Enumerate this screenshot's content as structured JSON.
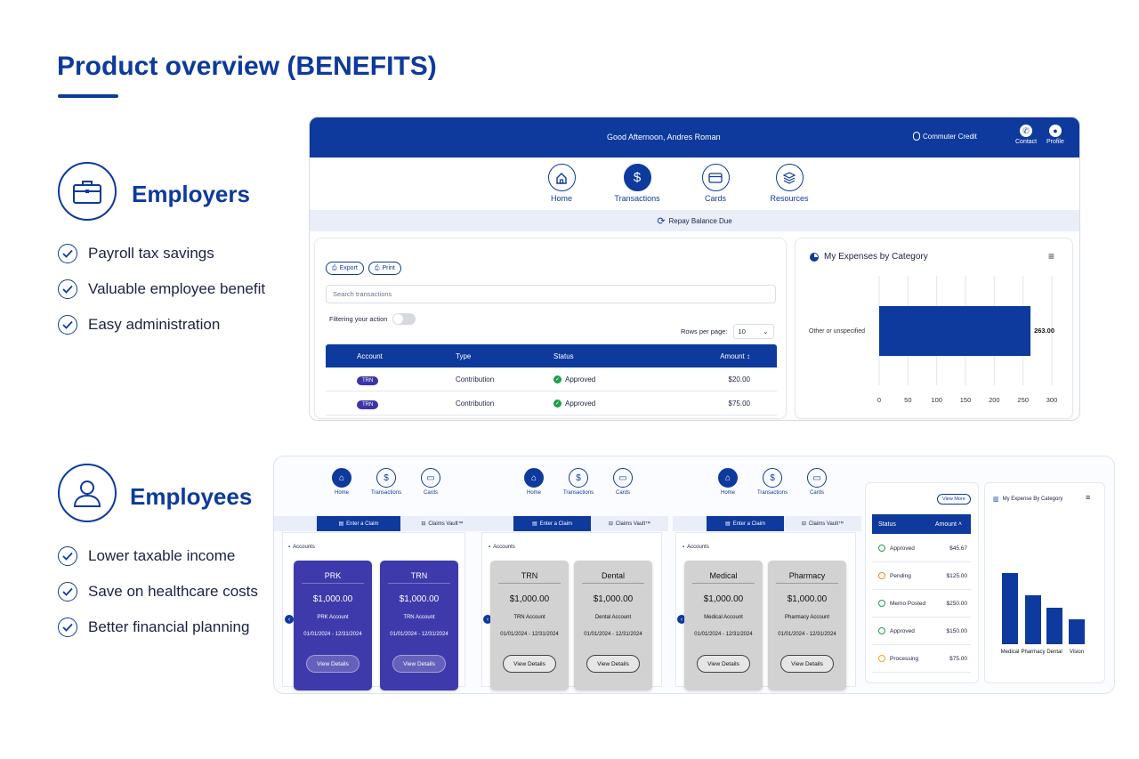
{
  "page_title": "Product overview (BENEFITS)",
  "employers": {
    "heading": "Employers",
    "features": [
      "Payroll tax savings",
      "Valuable employee benefit",
      "Easy administration"
    ]
  },
  "employees": {
    "heading": "Employees",
    "features": [
      "Lower taxable income",
      "Save on healthcare costs",
      "Better financial planning"
    ]
  },
  "dashboard": {
    "greeting": "Good Afternoon, Andres Roman",
    "commuter": "Commuter Credit",
    "contact": "Contact",
    "profile": "Profile",
    "nav": [
      "Home",
      "Transactions",
      "Cards",
      "Resources"
    ],
    "active_nav": "Transactions",
    "repay": "Repay Balance Due",
    "export": "Export",
    "print": "Print",
    "search_placeholder": "Search transactions",
    "filter_label": "Filtering your action",
    "rows_label": "Rows per page:",
    "rows_value": "10",
    "columns": [
      "Account",
      "Type",
      "Status",
      "Amount ↕"
    ],
    "rows": [
      {
        "account": "TRN",
        "type": "Contribution",
        "status": "Approved",
        "amount": "$20.00"
      },
      {
        "account": "TRN",
        "type": "Contribution",
        "status": "Approved",
        "amount": "$75.00"
      }
    ],
    "expenses_title": "My Expenses by Category"
  },
  "chart_data": [
    {
      "type": "bar",
      "orientation": "horizontal",
      "title": "My Expenses by Category",
      "categories": [
        "Other or unspecified"
      ],
      "values": [
        263
      ],
      "value_labels": [
        "263.00"
      ],
      "xlim": [
        0,
        300
      ],
      "xticks": [
        "0",
        "50",
        "100",
        "150",
        "200",
        "250",
        "300"
      ],
      "grid": true
    },
    {
      "type": "bar",
      "title": "My Expense By Category",
      "categories": [
        "Medical",
        "Pharmacy",
        "Dental",
        "Vision"
      ],
      "values": [
        80,
        55,
        41,
        28
      ],
      "yaxis_shown": false
    }
  ],
  "mobile": {
    "nav": [
      "Home",
      "Transactions",
      "Cards"
    ],
    "tab_claim": "Enter a Claim",
    "tab_vault": "Claims Vault™",
    "accounts_label": "Accounts",
    "view_details": "View Details",
    "screens": [
      [
        {
          "name": "PRK",
          "amount": "$1,000.00",
          "label": "PRK Account",
          "dates": "01/01/2024 - 12/31/2024",
          "style": "purple"
        },
        {
          "name": "TRN",
          "amount": "$1,000.00",
          "label": "TRN Account",
          "dates": "01/01/2024 - 12/31/2024",
          "style": "purple"
        }
      ],
      [
        {
          "name": "TRN",
          "amount": "$1,000.00",
          "label": "TRN Account",
          "dates": "01/01/2024 - 12/31/2024",
          "style": "gray"
        },
        {
          "name": "Dental",
          "amount": "$1,000.00",
          "label": "Dental Account",
          "dates": "01/01/2024 - 12/31/2024",
          "style": "gray"
        }
      ],
      [
        {
          "name": "Medical",
          "amount": "$1,000.00",
          "label": "Medical Account",
          "dates": "01/01/2024 - 12/31/2024",
          "style": "gray"
        },
        {
          "name": "Pharmacy",
          "amount": "$1,000.00",
          "label": "Pharmacy Account",
          "dates": "01/01/2024 - 12/31/2024",
          "style": "gray"
        }
      ]
    ],
    "status_panel": {
      "view_more": "View More",
      "columns": [
        "Status",
        "Amount ˄"
      ],
      "rows": [
        {
          "status": "Approved",
          "amount": "$45.67",
          "color": "#1e9e4a"
        },
        {
          "status": "Pending",
          "amount": "$125.00",
          "color": "#f08a24"
        },
        {
          "status": "Memo Posted",
          "amount": "$250.00",
          "color": "#1e9e4a"
        },
        {
          "status": "Approved",
          "amount": "$150.00",
          "color": "#1e9e4a"
        },
        {
          "status": "Processing",
          "amount": "$75.00",
          "color": "#f0a818"
        }
      ]
    },
    "expense_title": "My Expense By Category"
  },
  "colors": {
    "brand": "#0d3a9c",
    "purple": "#3f3aab",
    "approved": "#1e9e4a"
  }
}
